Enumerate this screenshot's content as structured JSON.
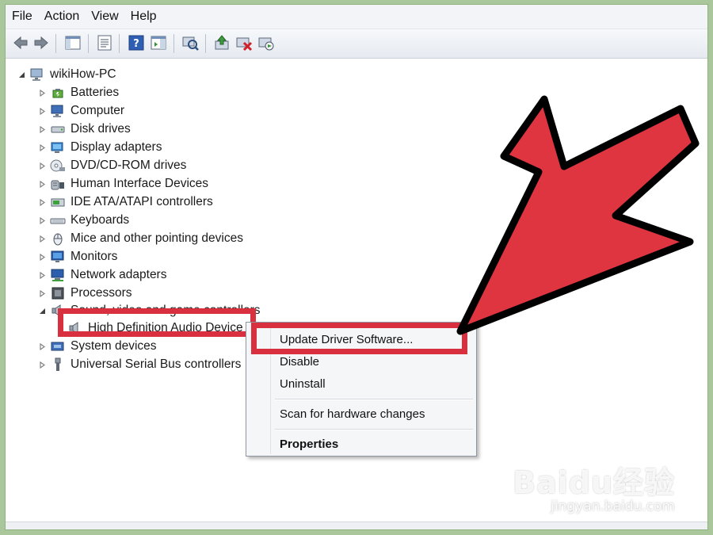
{
  "menu": [
    "File",
    "Action",
    "View",
    "Help"
  ],
  "toolbar": {
    "buttons": [
      "back-icon",
      "forward-icon",
      "show-hide-console-tree-icon",
      "properties-icon",
      "help-icon",
      "action-pane-icon",
      "scan-hardware-icon",
      "update-driver-icon",
      "uninstall-icon",
      "enable-device-icon"
    ]
  },
  "tree": {
    "root": "wikiHow-PC",
    "categories": [
      "Batteries",
      "Computer",
      "Disk drives",
      "Display adapters",
      "DVD/CD-ROM drives",
      "Human Interface Devices",
      "IDE ATA/ATAPI controllers",
      "Keyboards",
      "Mice and other pointing devices",
      "Monitors",
      "Network adapters",
      "Processors",
      "Sound, video and game controllers",
      "System devices",
      "Universal Serial Bus controllers"
    ],
    "selected_device": "High Definition Audio Device"
  },
  "context_menu": {
    "items": [
      "Update Driver Software...",
      "Disable",
      "Uninstall",
      "Scan for hardware changes",
      "Properties"
    ]
  },
  "annotation": {
    "highlight_color": "#d8303f",
    "arrow_color": "#de3540"
  },
  "watermark": {
    "logo": "Baidu经验",
    "url": "jingyan.baidu.com"
  }
}
